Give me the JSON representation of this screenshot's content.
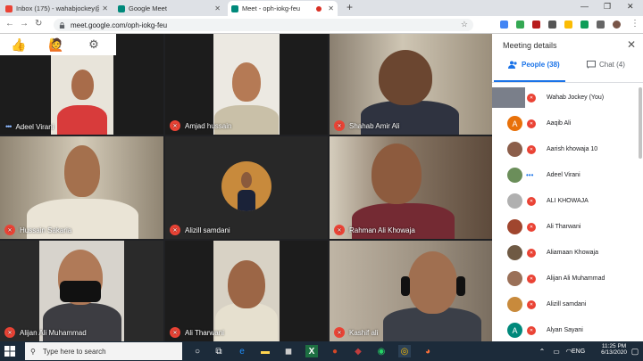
{
  "browser": {
    "tabs": [
      {
        "label": "Inbox (175) - wahabjockey@gm..."
      },
      {
        "label": "Google Meet"
      },
      {
        "label": "Meet - oph-iokg-feu"
      }
    ],
    "url": "meet.google.com/oph-iokg-feu"
  },
  "reactions": {
    "thumbs": "👍",
    "raise": "🙋",
    "settings": "⚙"
  },
  "tiles": [
    {
      "name": "Adeel Virani"
    },
    {
      "name": "Amjad hussain"
    },
    {
      "name": "Shahab Amir Ali"
    },
    {
      "name": "Hussain Sakaria"
    },
    {
      "name": "Alizill samdani"
    },
    {
      "name": "Rahman Ali Khowaja"
    },
    {
      "name": "Alijan Ali Muhammad"
    },
    {
      "name": "Ali Tharwani"
    },
    {
      "name": "Kashif ali"
    }
  ],
  "panel": {
    "title": "Meeting details",
    "people_tab": "People (38)",
    "chat_tab": "Chat (4)",
    "participants": [
      {
        "name": "Wahab Jockey (You)",
        "avatar": ""
      },
      {
        "name": "Aaqib Ali",
        "avatar": "A"
      },
      {
        "name": "Aarish khowaja 10",
        "avatar": ""
      },
      {
        "name": "Adeel Virani",
        "avatar": ""
      },
      {
        "name": "ALI KHOWAJA",
        "avatar": ""
      },
      {
        "name": "Ali Tharwani",
        "avatar": ""
      },
      {
        "name": "Aliamaan Khowaja",
        "avatar": ""
      },
      {
        "name": "Alijan Ali Muhammad",
        "avatar": ""
      },
      {
        "name": "Alizill samdani",
        "avatar": ""
      },
      {
        "name": "Alyan Sayani",
        "avatar": "A"
      }
    ]
  },
  "taskbar": {
    "search_placeholder": "Type here to search",
    "lang": "ENG",
    "time": "11:25 PM",
    "date": "6/13/2020"
  }
}
